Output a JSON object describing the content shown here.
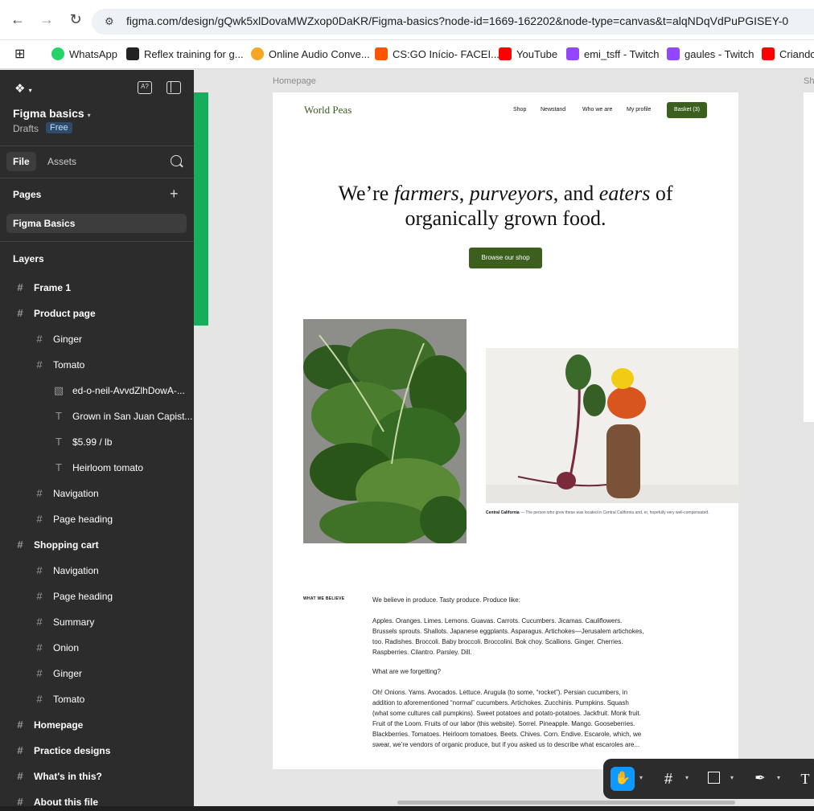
{
  "browser": {
    "url": "figma.com/design/gQwk5xlDovaMWZxop0DaKR/Figma-basics?node-id=1669-162202&node-type=canvas&t=alqNDqVdPuPGISEY-0",
    "bookmarks": [
      {
        "label": "WhatsApp",
        "color": "#25d366"
      },
      {
        "label": "Reflex training for g...",
        "color": "#222222"
      },
      {
        "label": "Online Audio Conve...",
        "color": "#f5a623"
      },
      {
        "label": "CS:GO Início- FACEI...",
        "color": "#ff5500"
      },
      {
        "label": "YouTube",
        "color": "#ff0000"
      },
      {
        "label": "emi_tsff - Twitch",
        "color": "#9146ff"
      },
      {
        "label": "gaules - Twitch",
        "color": "#9146ff"
      },
      {
        "label": "Criando",
        "color": "#ff0000"
      }
    ]
  },
  "left_panel": {
    "file_title": "Figma basics",
    "drafts": "Drafts",
    "plan_badge": "Free",
    "tabs": {
      "file": "File",
      "assets": "Assets"
    },
    "pages_title": "Pages",
    "current_page": "Figma Basics",
    "layers_title": "Layers",
    "layers": [
      {
        "label": "Frame 1",
        "icon": "#",
        "indent": 0,
        "bold": true
      },
      {
        "label": "Product page",
        "icon": "#",
        "indent": 0,
        "bold": true
      },
      {
        "label": "Ginger",
        "icon": "#",
        "indent": 1,
        "bold": false
      },
      {
        "label": "Tomato",
        "icon": "#",
        "indent": 1,
        "bold": false
      },
      {
        "label": "ed-o-neil-AvvdZlhDowA-...",
        "icon": "▧",
        "indent": 2,
        "bold": false
      },
      {
        "label": "Grown in San Juan Capist...",
        "icon": "T",
        "indent": 2,
        "bold": false
      },
      {
        "label": "$5.99 / lb",
        "icon": "T",
        "indent": 2,
        "bold": false
      },
      {
        "label": "Heirloom tomato",
        "icon": "T",
        "indent": 2,
        "bold": false
      },
      {
        "label": "Navigation",
        "icon": "#",
        "indent": 1,
        "bold": false
      },
      {
        "label": "Page heading",
        "icon": "#",
        "indent": 1,
        "bold": false
      },
      {
        "label": "Shopping cart",
        "icon": "#",
        "indent": 0,
        "bold": true
      },
      {
        "label": "Navigation",
        "icon": "#",
        "indent": 1,
        "bold": false
      },
      {
        "label": "Page heading",
        "icon": "#",
        "indent": 1,
        "bold": false
      },
      {
        "label": "Summary",
        "icon": "#",
        "indent": 1,
        "bold": false
      },
      {
        "label": "Onion",
        "icon": "#",
        "indent": 1,
        "bold": false
      },
      {
        "label": "Ginger",
        "icon": "#",
        "indent": 1,
        "bold": false
      },
      {
        "label": "Tomato",
        "icon": "#",
        "indent": 1,
        "bold": false
      },
      {
        "label": "Homepage",
        "icon": "#",
        "indent": 0,
        "bold": true
      },
      {
        "label": "Practice designs",
        "icon": "#",
        "indent": 0,
        "bold": true
      },
      {
        "label": "What's in this?",
        "icon": "#",
        "indent": 0,
        "bold": true
      },
      {
        "label": "About this file",
        "icon": "#",
        "indent": 0,
        "bold": true
      }
    ]
  },
  "canvas": {
    "frame_label": "Homepage",
    "frame_label_right": "Sh",
    "homepage": {
      "logo": "World Peas",
      "nav": [
        "Shop",
        "Newstand",
        "Who we are",
        "My profile"
      ],
      "basket": "Basket (3)",
      "hero_line1_a": "We’re ",
      "hero_line1_b": "farmers",
      "hero_line1_c": ", ",
      "hero_line1_d": "purveyors",
      "hero_line1_e": ", and ",
      "hero_line1_f": "eaters",
      "hero_line1_g": " of",
      "hero_line2": "organically grown food.",
      "cta": "Browse our shop",
      "caption_bold": "Central California",
      "caption_text": " — The person who grew these was located in Central California and, er, hopefully very well-compensated.",
      "believe_label": "WHAT WE BELIEVE",
      "paragraphs": [
        "We believe in produce. Tasty produce. Produce like:",
        "Apples. Oranges. Limes. Lemons. Guavas. Carrots. Cucumbers. Jicamas. Cauliflowers. Brussels sprouts. Shallots. Japanese eggplants. Asparagus. Artichokes—Jerusalem artichokes, too. Radishes. Broccoli. Baby broccoli. Broccolini. Bok choy. Scallions. Ginger. Cherries. Raspberries. Cilantro. Parsley. Dill.",
        "What are we forgetting?",
        "Oh! Onions. Yams. Avocados. Lettuce. Arugula (to some, “rocket”). Persian cucumbers, in addition to aforementioned “normal” cucumbers. Artichokes. Zucchinis. Pumpkins. Squash (what some cultures call pumpkins). Sweet potatoes and potato-potatoes. Jackfruit. Monk fruit. Fruit of the Loom. Fruits of our labor (this website). Sorrel. Pineapple. Mango. Gooseberries. Blackberries. Tomatoes. Heirloom tomatoes. Beets. Chives. Corn. Endive. Escarole, which, we swear, we’re vendors of organic produce, but if you asked us to describe what escaroles are..."
      ]
    }
  },
  "toolbar": {
    "tools": [
      "hand-tool",
      "frame-tool",
      "shape-tool",
      "pen-tool",
      "text-tool"
    ],
    "text_tool_glyph": "T"
  }
}
